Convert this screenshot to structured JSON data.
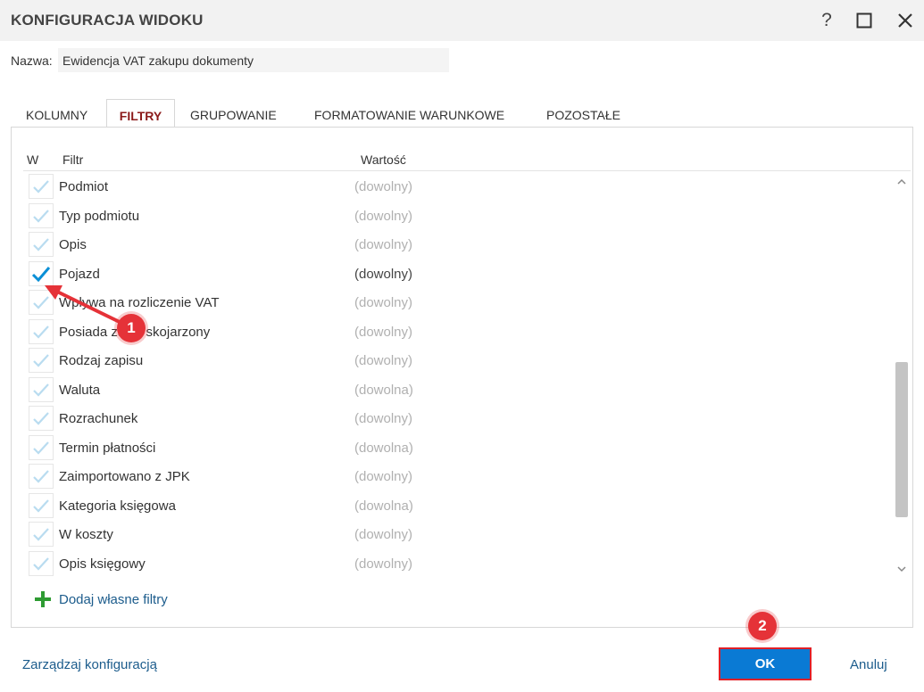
{
  "window": {
    "title": "KONFIGURACJA WIDOKU",
    "help_label": "?"
  },
  "name_field": {
    "label": "Nazwa:",
    "value": "Ewidencja VAT zakupu dokumenty"
  },
  "tabs": [
    {
      "label": "KOLUMNY",
      "active": false
    },
    {
      "label": "FILTRY",
      "active": true
    },
    {
      "label": "GRUPOWANIE",
      "active": false
    },
    {
      "label": "FORMATOWANIE WARUNKOWE",
      "active": false
    },
    {
      "label": "POZOSTAŁE",
      "active": false
    }
  ],
  "filter_table": {
    "headers": {
      "w": "W",
      "filtr": "Filtr",
      "wartosc": "Wartość"
    },
    "rows": [
      {
        "name": "Podmiot",
        "value": "(dowolny)",
        "checked": false
      },
      {
        "name": "Typ podmiotu",
        "value": "(dowolny)",
        "checked": false
      },
      {
        "name": "Opis",
        "value": "(dowolny)",
        "checked": false
      },
      {
        "name": "Pojazd",
        "value": "(dowolny)",
        "checked": true
      },
      {
        "name": "Wpływa na rozliczenie VAT",
        "value": "(dowolny)",
        "checked": false
      },
      {
        "name": "Posiada zapis skojarzony",
        "value": "(dowolny)",
        "checked": false
      },
      {
        "name": "Rodzaj zapisu",
        "value": "(dowolny)",
        "checked": false
      },
      {
        "name": "Waluta",
        "value": "(dowolna)",
        "checked": false
      },
      {
        "name": "Rozrachunek",
        "value": "(dowolny)",
        "checked": false
      },
      {
        "name": "Termin płatności",
        "value": "(dowolna)",
        "checked": false
      },
      {
        "name": "Zaimportowano z JPK",
        "value": "(dowolny)",
        "checked": false
      },
      {
        "name": "Kategoria księgowa",
        "value": "(dowolna)",
        "checked": false
      },
      {
        "name": "W koszty",
        "value": "(dowolny)",
        "checked": false
      },
      {
        "name": "Opis księgowy",
        "value": "(dowolny)",
        "checked": false
      }
    ]
  },
  "add_filter_label": "Dodaj własne filtry",
  "footer": {
    "manage_label": "Zarządzaj konfiguracją",
    "ok_label": "OK",
    "cancel_label": "Anuluj"
  },
  "annotations": [
    {
      "number": "1"
    },
    {
      "number": "2"
    }
  ],
  "colors": {
    "active_tab_text": "#8b1a1a",
    "check_active": "#0a8fd6",
    "check_inactive": "#b9dcf0",
    "link": "#1c5c8c",
    "ok_button": "#0a7ad4",
    "annotation_red": "#e53238",
    "add_plus": "#2e9b32"
  },
  "icons": {
    "help": "question-mark-icon",
    "maximize": "maximize-icon",
    "close": "close-icon",
    "check": "check-icon",
    "add": "plus-icon",
    "scroll_up": "chevron-up-icon",
    "scroll_down": "chevron-down-icon"
  }
}
